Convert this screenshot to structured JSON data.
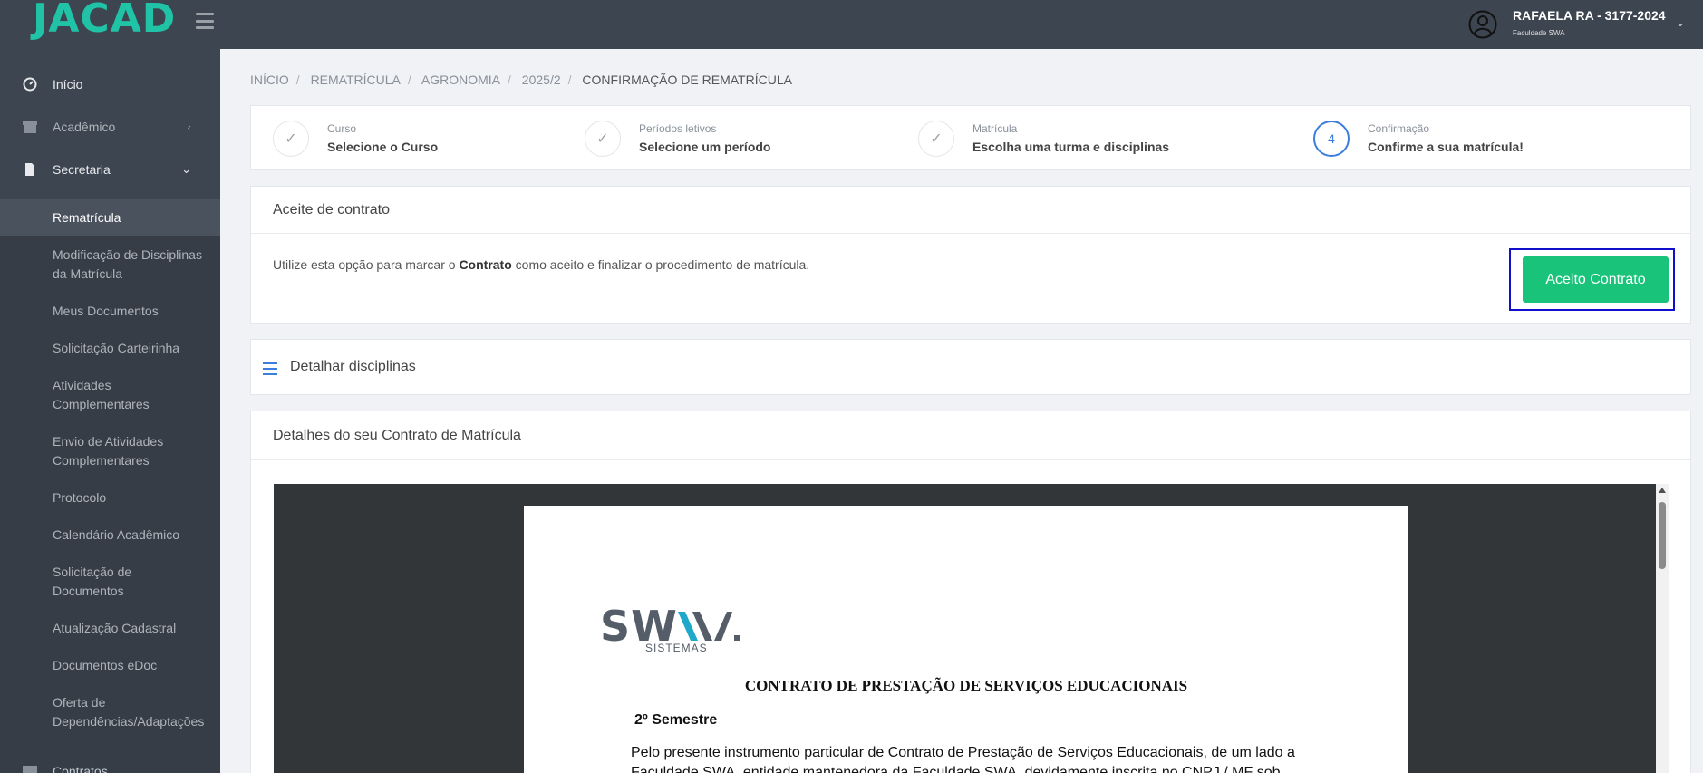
{
  "sidebar": {
    "logo": "JACAD",
    "nav": [
      {
        "label": "Início",
        "icon": "dashboard-icon"
      },
      {
        "label": "Acadêmico",
        "icon": "archive-icon"
      },
      {
        "label": "Secretaria",
        "icon": "file-icon"
      }
    ],
    "submenu": [
      "Rematrícula",
      "Modificação de Disciplinas da Matrícula",
      "Meus Documentos",
      "Solicitação Carteirinha",
      "Atividades Complementares",
      "Envio de Atividades Complementares",
      "Protocolo",
      "Calendário Acadêmico",
      "Solicitação de Documentos",
      "Atualização Cadastral",
      "Documentos eDoc",
      "Oferta de Dependências/Adaptações"
    ],
    "bottom_item": "Contratos"
  },
  "user": {
    "name": "RAFAELA RA - 3177-2024",
    "org": "Faculdade SWA"
  },
  "breadcrumb": [
    "INÍCIO",
    "REMATRÍCULA",
    "AGRONOMIA",
    "2025/2",
    "CONFIRMAÇÃO DE REMATRÍCULA"
  ],
  "steps": [
    {
      "label": "Curso",
      "title": "Selecione o Curso",
      "marker": "✓"
    },
    {
      "label": "Períodos letivos",
      "title": "Selecione um período",
      "marker": "✓"
    },
    {
      "label": "Matrícula",
      "title": "Escolha uma turma e disciplinas",
      "marker": "✓"
    },
    {
      "label": "Confirmação",
      "title": "Confirme a sua matrícula!",
      "marker": "4"
    }
  ],
  "contract": {
    "header": "Aceite de contrato",
    "text_before": "Utilize esta opção para marcar o ",
    "text_bold": "Contrato",
    "text_after": " como aceito e finalizar o procedimento de matrícula.",
    "button": "Aceito Contrato"
  },
  "details": {
    "title": "Detalhar disciplinas"
  },
  "contract_details": {
    "header": "Detalhes do seu Contrato de Matrícula",
    "doc_logo": "SW",
    "doc_logo_sub": "SISTEMAS",
    "doc_title": "CONTRATO DE PRESTAÇÃO DE SERVIÇOS EDUCACIONAIS",
    "doc_semester": "2º Semestre",
    "doc_para": "Pelo presente instrumento particular de Contrato de Prestação de Serviços Educacionais, de um lado a Faculdade SWA, entidade mantenedora da Faculdade SWA, devidamente inscrita no CNPJ / MF sob"
  },
  "colors": {
    "sidebar": "#3d4550",
    "accent": "#20c3a6",
    "button": "#19c37a",
    "active_step": "#3b7ddd",
    "highlight": "#1010cc"
  }
}
